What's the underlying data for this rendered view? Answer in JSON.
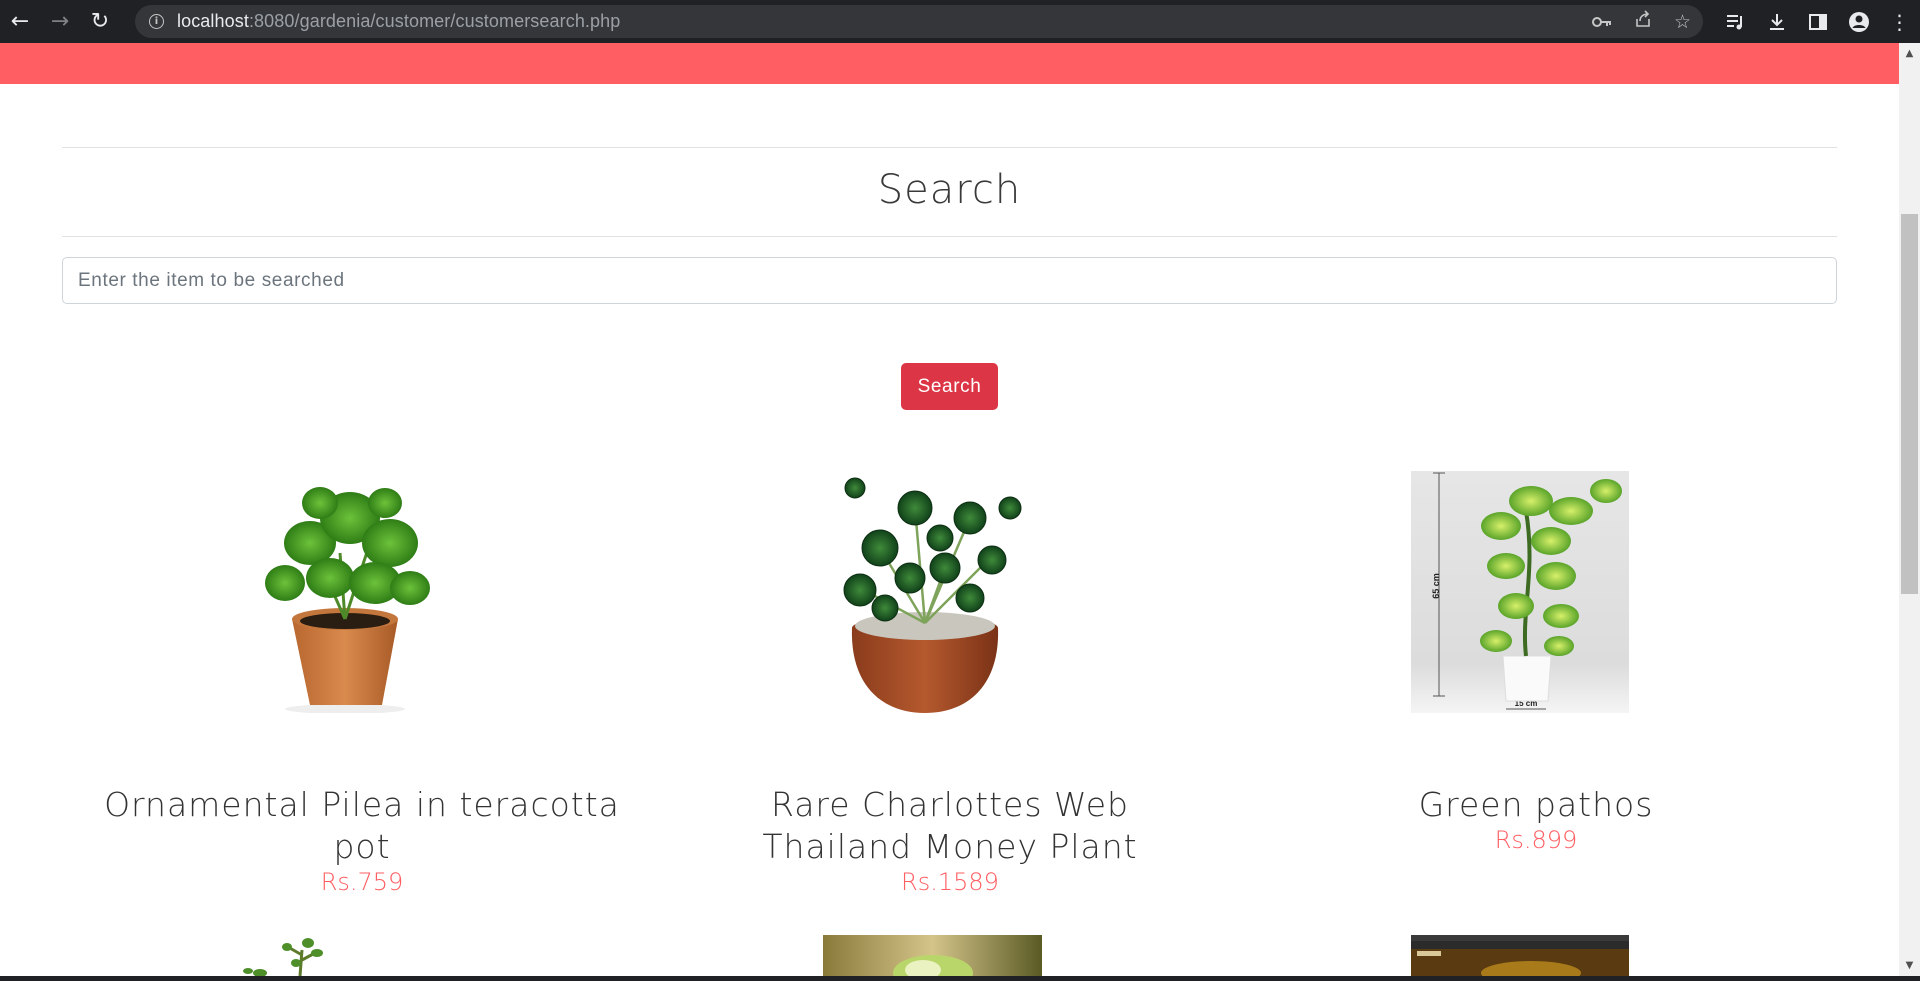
{
  "browser": {
    "url_host": "localhost",
    "url_rest": ":8080/gardenia/customer/customersearch.php"
  },
  "page": {
    "title": "Search",
    "search_placeholder": "Enter the item to be searched",
    "search_button": "Search"
  },
  "products": [
    {
      "name": "Ornamental Pilea in teracotta pot",
      "price": "Rs.759"
    },
    {
      "name": "Rare Charlottes Web Thailand Money Plant",
      "price": "Rs.1589"
    },
    {
      "name": "Green pathos",
      "price": "Rs.899"
    }
  ],
  "dimension_labels": {
    "height": "65 cm",
    "width": "15 cm"
  },
  "colors": {
    "header_bar": "#ff5e62",
    "price": "#ff5e62",
    "search_button": "#dc3545"
  }
}
